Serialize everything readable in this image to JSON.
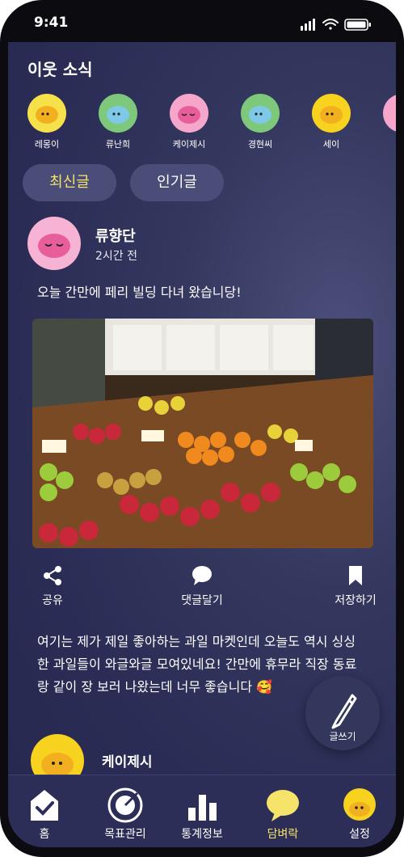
{
  "status": {
    "time": "9:41"
  },
  "section": {
    "title": "이웃 소식"
  },
  "friends": [
    {
      "name": "레몽이",
      "color": "#f7e14a"
    },
    {
      "name": "류난희",
      "color": "#7dc87a"
    },
    {
      "name": "케이제시",
      "color": "#f7a6cb"
    },
    {
      "name": "경현씨",
      "color": "#7dc87a"
    },
    {
      "name": "세이",
      "color": "#f7d21f"
    }
  ],
  "tabs": {
    "latest": "최신글",
    "popular": "인기글"
  },
  "post": {
    "author": "류향단",
    "time": "2시간 전",
    "title": "오늘 간만에 페리 빌딩 다녀 왔습니당!",
    "body": "여기는 제가 제일 좋아하는 과일 마켓인데 오늘도 역시 싱싱한 과일들이 와글와글 모여있네요! 간만에 휴무라 직장 동료랑 같이 장 보러 나왔는데 너무 좋습니다 🥰"
  },
  "actions": {
    "share": "공유",
    "comment": "댓글달기",
    "save": "저장하기"
  },
  "write_button": {
    "label": "글쓰기"
  },
  "next_post": {
    "author": "케이제시"
  },
  "nav": {
    "home": "홈",
    "goals": "목표관리",
    "stats": "통계정보",
    "wall": "담벼락",
    "settings": "설정"
  },
  "colors": {
    "accent": "#f6e46a",
    "background": "#2a2c55"
  }
}
